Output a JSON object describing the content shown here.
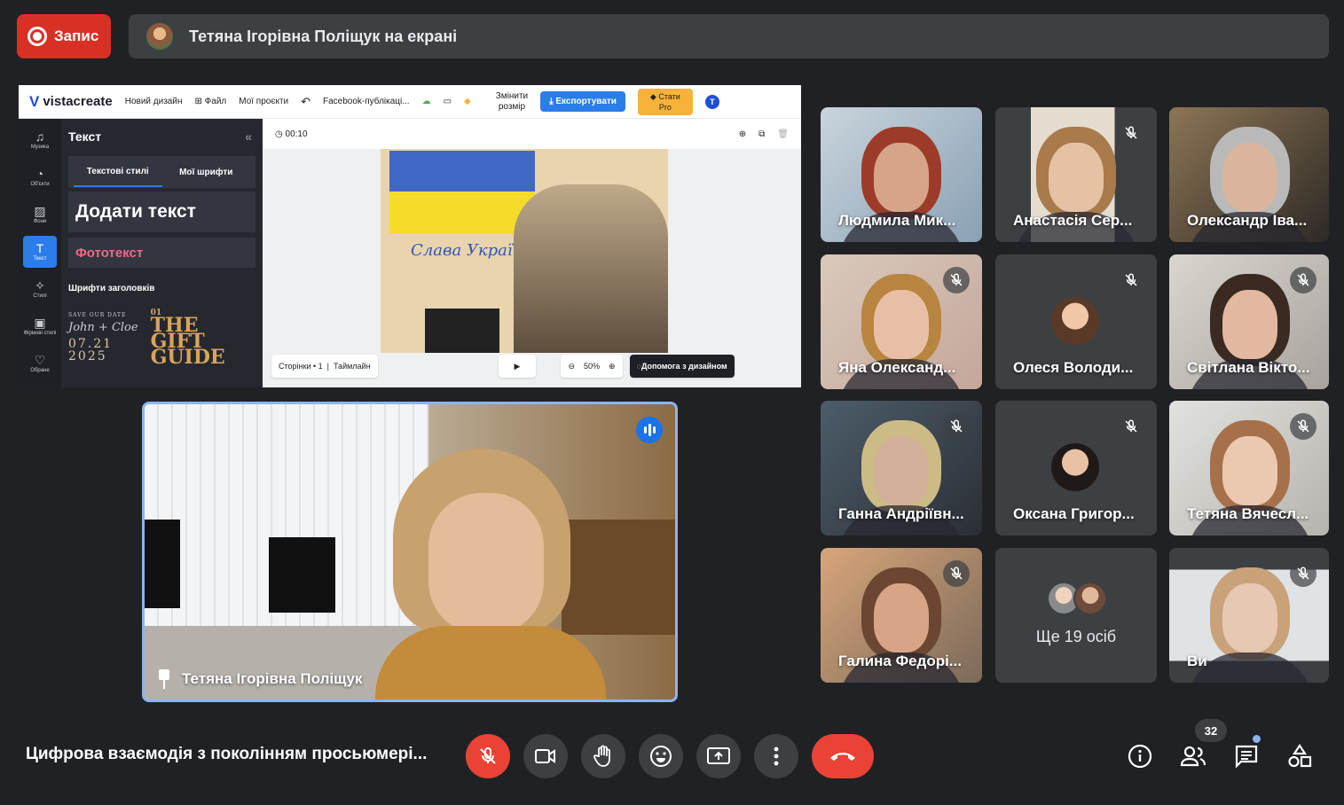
{
  "recording": {
    "label": "Запис"
  },
  "presenter_bar": {
    "text": "Тетяна Ігорівна Поліщук на екрані"
  },
  "shared_screen": {
    "app": "vistacreate",
    "menu": [
      "Новий дизайн",
      "Файл",
      "Мої проєкти"
    ],
    "doc_title": "Facebook-публікаці...",
    "resize": [
      "Змінити",
      "розмір"
    ],
    "export": "Експортувати",
    "pro": [
      "Стати",
      "Pro"
    ],
    "user_initial": "T",
    "rail": [
      {
        "icon": "♫",
        "label": "Музика"
      },
      {
        "icon": "◔",
        "label": "Об'єкти"
      },
      {
        "icon": "▨",
        "label": "Фони"
      },
      {
        "icon": "T",
        "label": "Текст"
      },
      {
        "icon": "✧",
        "label": "Стилі"
      },
      {
        "icon": "▣",
        "label": "Фірмові стилі"
      },
      {
        "icon": "♡",
        "label": "Обране"
      }
    ],
    "panel_title": "Текст",
    "tabs": [
      "Текстові стилі",
      "Мої шрифти"
    ],
    "add_text": "Додати текст",
    "photo_text": "Фототекст",
    "headline_fonts": "Шрифти заголовків",
    "font_preview_1": [
      "SAVE OUR DATE",
      "John + Cloe",
      "07.21",
      "2025"
    ],
    "font_preview_2": [
      "01",
      "THE",
      "GIFT",
      "GUIDE"
    ],
    "timer": "00:10",
    "poster_text": "Слава Україні!",
    "pages": "Сторінки • 1",
    "timeline": "Таймлайн",
    "zoom": "50%",
    "help": "Допомога з дизайном"
  },
  "speaker": {
    "name": "Тетяна Ігорівна Поліщук"
  },
  "tiles": [
    {
      "name": "Людмила Мик...",
      "muted": false
    },
    {
      "name": "Анастасія Сер...",
      "muted": true
    },
    {
      "name": "Олександр Іва...",
      "muted": false
    },
    {
      "name": "Яна Олександ...",
      "muted": true
    },
    {
      "name": "Олеся Володи...",
      "muted": true
    },
    {
      "name": "Світлана Вікто...",
      "muted": true
    },
    {
      "name": "Ганна Андріївн...",
      "muted": true
    },
    {
      "name": "Оксана Григор...",
      "muted": true
    },
    {
      "name": "Тетяна Вячесл...",
      "muted": true
    },
    {
      "name": "Галина Федорі...",
      "muted": true
    },
    {
      "name": "Ще 19 осіб",
      "muted": false
    },
    {
      "name": "Ви",
      "muted": true
    }
  ],
  "bottom": {
    "meeting_title": "Цифрова взаємодія з поколінням просьюмері...",
    "participants_count": "32"
  },
  "colors": {
    "accent": "#8ab4f8",
    "red": "#ea4335",
    "bg": "#202124",
    "tile": "#3c4043"
  }
}
